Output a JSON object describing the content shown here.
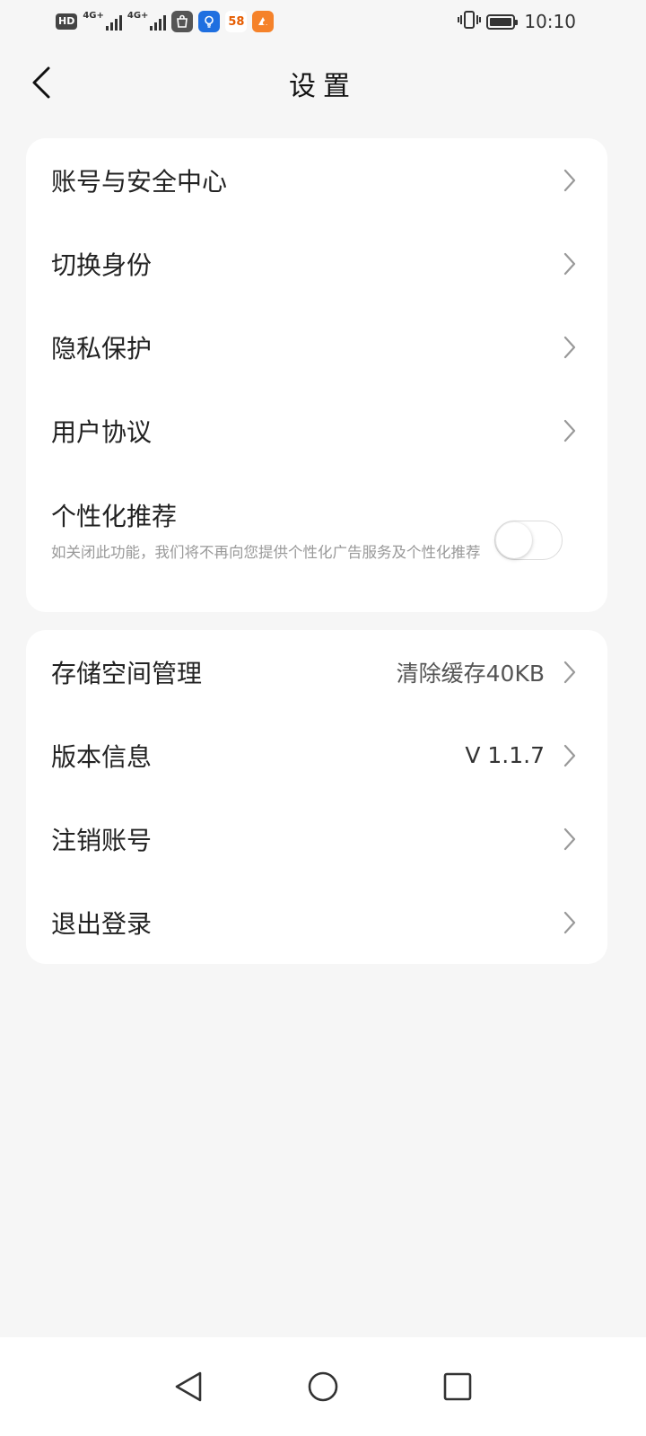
{
  "status_bar": {
    "hd_label": "HD",
    "net1": "4G+",
    "net2": "4G+",
    "app58_label": "58",
    "time": "10:10"
  },
  "header": {
    "title": "设置",
    "back_icon": "chevron-left-icon"
  },
  "section1": {
    "account_security": "账号与安全中心",
    "switch_identity": "切换身份",
    "privacy": "隐私保护",
    "user_agreement": "用户协议",
    "personalized_title": "个性化推荐",
    "personalized_desc": "如关闭此功能，我们将不再向您提供个性化广告服务及个性化推荐",
    "personalized_on": false
  },
  "section2": {
    "storage_label": "存储空间管理",
    "storage_value": "清除缓存40KB",
    "version_label": "版本信息",
    "version_value": "V 1.1.7",
    "deactivate": "注销账号",
    "logout": "退出登录"
  },
  "colors": {
    "background": "#f6f6f6",
    "card": "#ffffff",
    "chevron": "#999999"
  }
}
